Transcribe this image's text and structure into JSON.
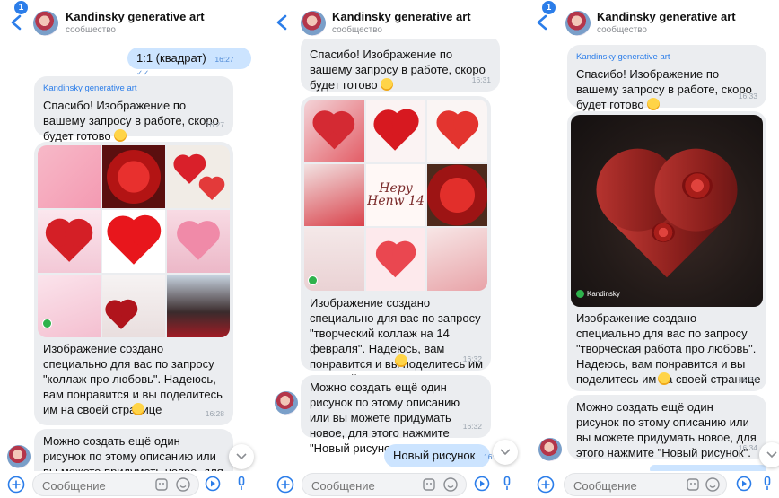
{
  "header": {
    "name": "Kandinsky generative art",
    "subtitle": "сообщество",
    "unread_badge": "1"
  },
  "composer": {
    "placeholder": "Сообщение"
  },
  "colors": {
    "accent": "#2b7de9",
    "incoming_bubble": "#ebedf0",
    "outgoing_bubble": "#cce4ff",
    "kandinsky_green": "#2eb24c"
  },
  "icons": [
    "back-arrow-icon",
    "plus-icon",
    "sticker-icon",
    "emoji-icon",
    "bot-command-icon",
    "microphone-icon",
    "chevron-down-icon"
  ],
  "panel1": {
    "out_message": {
      "text": "1:1 (квадрат)",
      "time": "16:27"
    },
    "reply": {
      "sender": "Kandinsky generative art",
      "text": "Спасибо! Изображение по вашему запросу в работе, скоро будет готово",
      "time": "16:27"
    },
    "result": {
      "text": "Изображение создано специально для вас по запросу \"коллаж про любовь\". Надеюсь, вам понравится и вы поделитесь им на своей странице",
      "time": "16:28"
    },
    "followup": {
      "text": "Можно создать ещё один рисунок по этому описанию или вы можете придумать новое, для этого"
    }
  },
  "panel2": {
    "reply_tail": {
      "text": "Спасибо! Изображение по вашему запросу в работе, скоро будет готово",
      "time": "16:31"
    },
    "collage_text": "Hepy Henw 14",
    "result": {
      "text": "Изображение создано специально для вас по запросу \"творческий коллаж на 14 февраля\". Надеюсь, вам понравится и вы поделитесь им на своей странице",
      "time": "16:32"
    },
    "followup": {
      "text": "Можно создать ещё один рисунок по этому описанию или вы можете придумать новое, для этого нажмите \"Новый рисунок\".",
      "time": "16:32"
    },
    "out_message": {
      "text": "Новый рисунок",
      "time": "16:3"
    }
  },
  "panel3": {
    "reply": {
      "sender": "Kandinsky generative art",
      "text": "Спасибо! Изображение по вашему запросу в работе, скоро будет готово",
      "time": "16:33"
    },
    "image_label": "Kandinsky",
    "result": {
      "text": "Изображение создано специально для вас по запросу \"творческая работа про любовь\". Надеюсь, вам понравится и вы поделитесь им на своей странице",
      "time": "16:34"
    },
    "followup": {
      "text": "Можно создать ещё один рисунок по этому описанию или вы можете придумать новое, для этого нажмите \"Новый рисунок\".",
      "time": "16:34"
    }
  }
}
